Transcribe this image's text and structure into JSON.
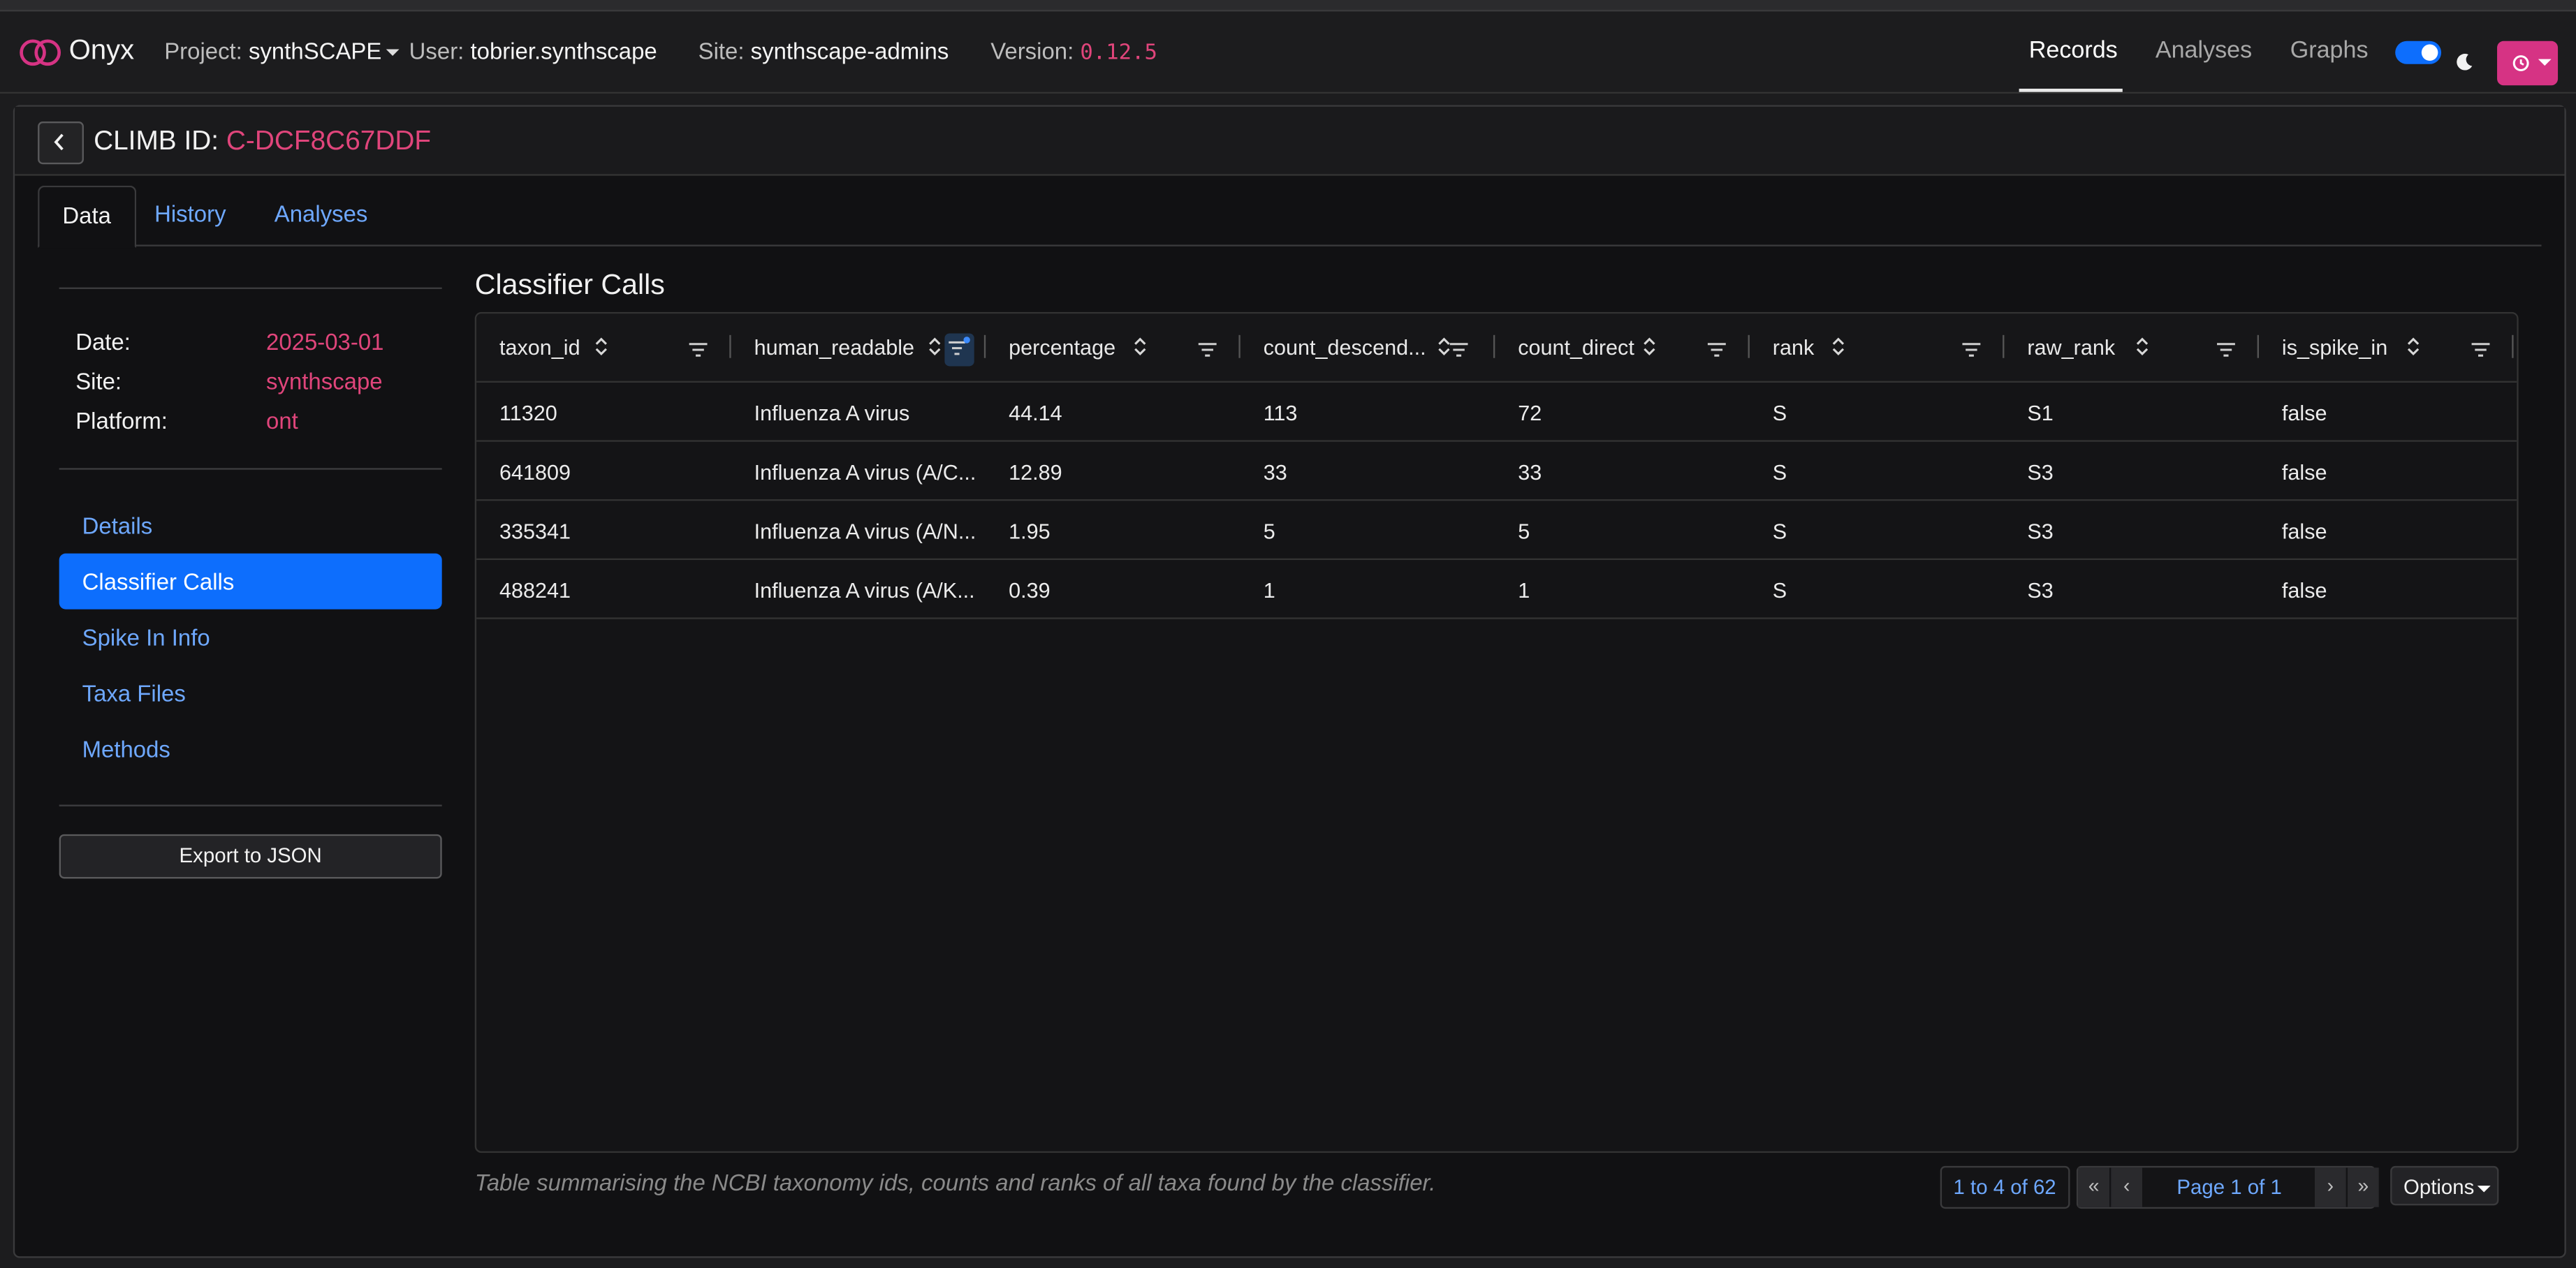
{
  "navbar": {
    "brand": "Onyx",
    "project_label": "Project:",
    "project_value": "synthSCAPE",
    "user_label": "User:",
    "user_value": "tobrier.synthscape",
    "site_label": "Site:",
    "site_value": "synthscape-admins",
    "version_label": "Version:",
    "version_value": "0.12.5",
    "links": [
      "Records",
      "Analyses",
      "Graphs"
    ],
    "active_link": "Records",
    "dark_mode": true
  },
  "record": {
    "id_label": "CLIMB ID:",
    "id_value": "C-DCF8C67DDF"
  },
  "tabs": [
    "Data",
    "History",
    "Analyses"
  ],
  "active_tab": "Data",
  "sidebar": {
    "meta": [
      {
        "label": "Date:",
        "value": "2025-03-01"
      },
      {
        "label": "Site:",
        "value": "synthscape"
      },
      {
        "label": "Platform:",
        "value": "ont"
      }
    ],
    "items": [
      "Details",
      "Classifier Calls",
      "Spike In Info",
      "Taxa Files",
      "Methods"
    ],
    "active_item": "Classifier Calls",
    "export_label": "Export to JSON"
  },
  "section": {
    "title": "Classifier Calls",
    "caption": "Table summarising the NCBI taxonomy ids, counts and ranks of all taxa found by the classifier."
  },
  "table": {
    "columns": [
      "taxon_id",
      "human_readable",
      "percentage",
      "count_descend...",
      "count_direct",
      "rank",
      "raw_rank",
      "is_spike_in"
    ],
    "rows": [
      [
        "11320",
        "Influenza A virus",
        "44.14",
        "113",
        "72",
        "S",
        "S1",
        "false"
      ],
      [
        "641809",
        "Influenza A virus (A/C...",
        "12.89",
        "33",
        "33",
        "S",
        "S3",
        "false"
      ],
      [
        "335341",
        "Influenza A virus (A/N...",
        "1.95",
        "5",
        "5",
        "S",
        "S3",
        "false"
      ],
      [
        "488241",
        "Influenza A virus (A/K...",
        "0.39",
        "1",
        "1",
        "S",
        "S3",
        "false"
      ]
    ]
  },
  "pagination": {
    "info": "1 to 4 of 62",
    "first": "«",
    "prev": "‹",
    "page_text": "Page 1 of 1",
    "next": "›",
    "last": "»",
    "options_label": "Options"
  },
  "colors": {
    "accent_pink": "#d63384",
    "accent_blue": "#0d6efd",
    "link_blue": "#6ea8fe"
  }
}
